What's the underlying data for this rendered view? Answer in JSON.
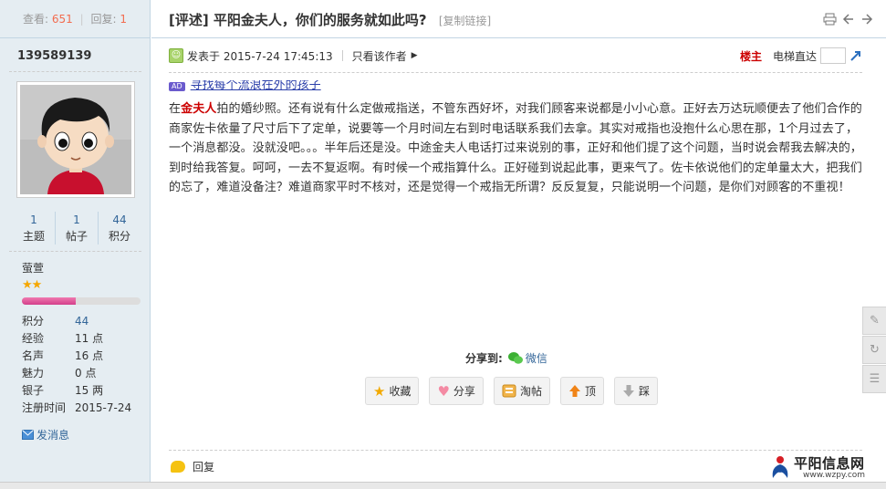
{
  "left": {
    "views_label": "查看:",
    "views_value": "651",
    "replies_label": "回复:",
    "replies_value": "1",
    "username": "139589139",
    "counts": [
      {
        "value": "1",
        "label": "主题"
      },
      {
        "value": "1",
        "label": "帖子"
      },
      {
        "value": "44",
        "label": "积分"
      }
    ],
    "rank": "萤萱",
    "stars": "★★",
    "progress_fraction": 0.45,
    "info": [
      {
        "key": "积分",
        "value": "44"
      },
      {
        "key": "经验",
        "value": "11 点"
      },
      {
        "key": "名声",
        "value": "16 点"
      },
      {
        "key": "魅力",
        "value": "0 点"
      },
      {
        "key": "银子",
        "value": "15 两"
      },
      {
        "key": "注册时间",
        "value": "2015-7-24"
      }
    ],
    "message_label": "发消息"
  },
  "thread": {
    "title": "[评述] 平阳金夫人，你们的服务就如此吗?",
    "copy_link": "[复制链接]",
    "icons": [
      "printer-icon",
      "prev-icon",
      "next-icon"
    ]
  },
  "post": {
    "posted": "发表于 2015-7-24 17:45:13",
    "author_only": "只看该作者",
    "louzhu": "楼主",
    "elevator": "电梯直达",
    "ad_tag": "AD",
    "ad_text": "寻找每个流浪在外的孩子",
    "body_pre": "在",
    "body_kw": "金夫人",
    "body_post": "拍的婚纱照。还有说有什么定做戒指送，不管东西好坏，对我们顾客来说都是小小心意。正好去万达玩顺便去了他们合作的商家佐卡依量了尺寸后下了定单，说要等一个月时间左右到时电话联系我们去拿。其实对戒指也没抱什么心思在那，1个月过去了，一个消息都没。没就没吧。。。半年后还是没。中途金夫人电话打过来说别的事，正好和他们提了这个问题，当时说会帮我去解决的，到时给我答复。呵呵，一去不复返啊。有时候一个戒指算什么。正好碰到说起此事，更来气了。佐卡依说他们的定单量太大，把我们的忘了，难道没备注？难道商家平时不核对，还是觉得一个戒指无所谓？反反复复，只能说明一个问题，是你们对顾客的不重视！"
  },
  "share": {
    "label": "分享到:",
    "wechat": "微信"
  },
  "actions": [
    {
      "label": "收藏",
      "icon": "star-icon"
    },
    {
      "label": "分享",
      "icon": "heart-icon"
    },
    {
      "label": "淘帖",
      "icon": "tray-icon"
    },
    {
      "label": "顶",
      "icon": "up-arrow-icon"
    },
    {
      "label": "踩",
      "icon": "down-arrow-icon"
    }
  ],
  "reply": {
    "label": "回复"
  },
  "logo": {
    "name": "平阳信息网",
    "url": "www.wzpy.com"
  },
  "colors": {
    "sidebar_bg": "#e5edf2",
    "accent_red": "#cc0000",
    "link_blue": "#336699"
  }
}
